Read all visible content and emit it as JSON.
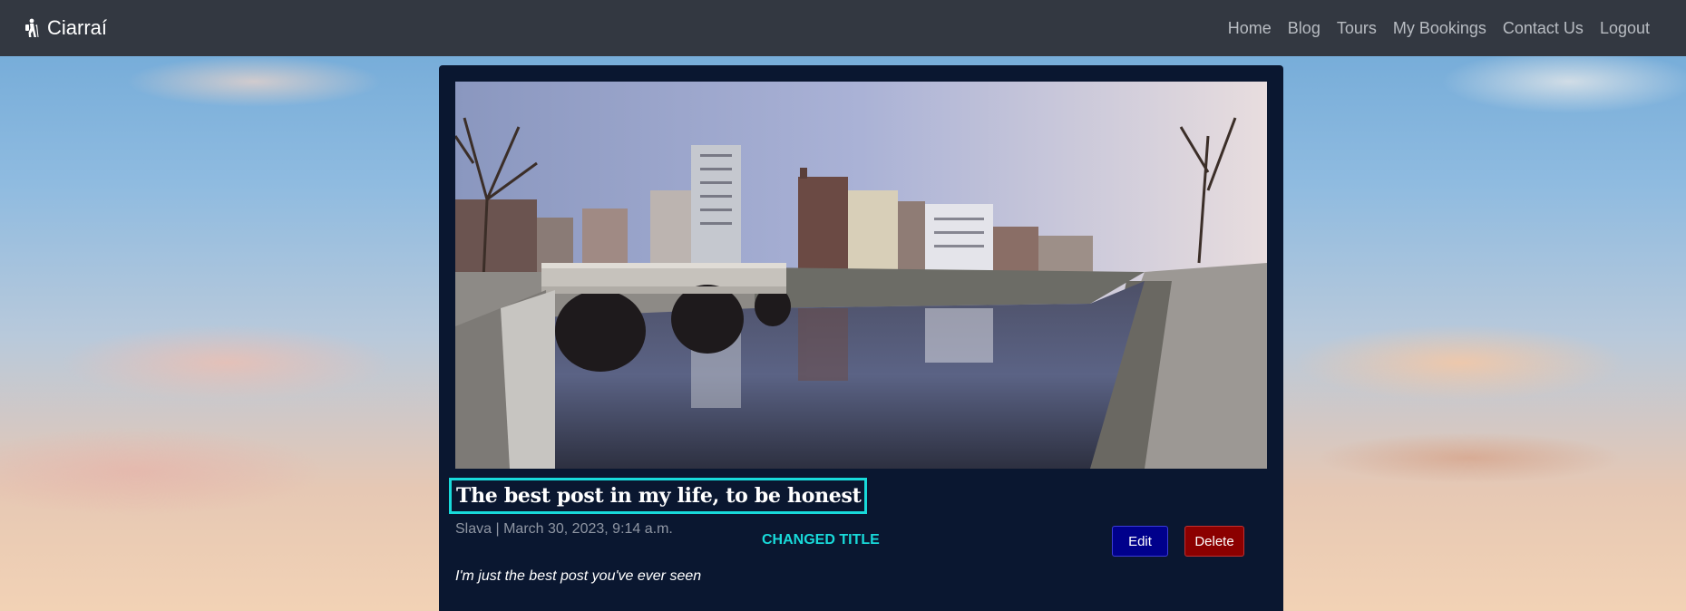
{
  "navbar": {
    "brand": "Ciarraí",
    "links": [
      "Home",
      "Blog",
      "Tours",
      "My Bookings",
      "Contact Us",
      "Logout"
    ]
  },
  "post": {
    "title": "The best post in my life, to be honest",
    "author": "Slava",
    "separator": "|",
    "date": "March 30, 2023, 9:14 a.m.",
    "excerpt": "I'm just the best post you've ever seen",
    "edit_label": "Edit",
    "delete_label": "Delete"
  },
  "annotation": "CHANGED TITLE",
  "colors": {
    "navbar_bg": "#333841",
    "card_bg": "#0a1730",
    "highlight": "#18dada",
    "edit_button": "#00008b",
    "delete_button": "#8b0000"
  },
  "icons": {
    "brand": "hiking-icon"
  }
}
